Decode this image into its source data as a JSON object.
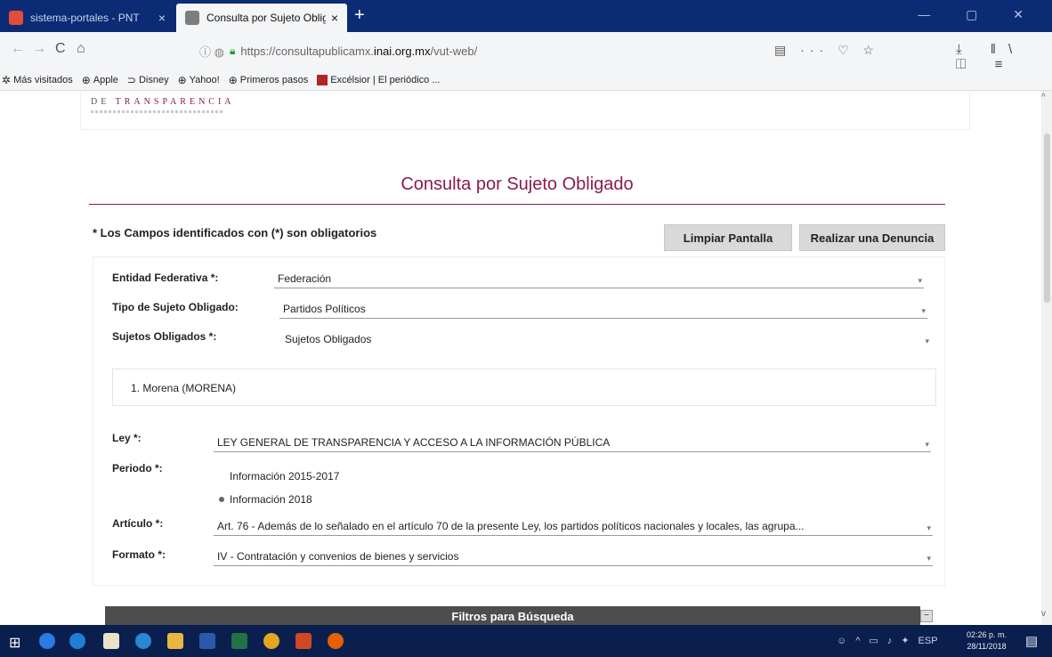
{
  "browser": {
    "tabs": [
      {
        "label": "sistema-portales - PNT",
        "close": "×",
        "active": false
      },
      {
        "label": "Consulta por Sujeto Obligado",
        "close": "×",
        "active": true
      }
    ],
    "new_tab": "+",
    "nav": {
      "back": "←",
      "forward": "→",
      "reload": "C",
      "home": "⌂"
    },
    "url_prefix": "https://consultapublicamx.",
    "url_domain": "inai.org.mx",
    "url_suffix": "/vut-web/",
    "url_actions": "▤ ··· ♡ ☆",
    "toolbar_right": "⤓ ‖\\ ◫ ≡",
    "bookmarks": [
      {
        "label": "Más visitados",
        "icon": "gear-icon"
      },
      {
        "label": "Apple",
        "icon": "globe-icon"
      },
      {
        "label": "Disney",
        "icon": "disney-icon"
      },
      {
        "label": "Yahoo!",
        "icon": "globe-icon"
      },
      {
        "label": "Primeros pasos",
        "icon": "globe-icon"
      },
      {
        "label": "Excélsior | El periódico ...",
        "icon": "excelsior-icon"
      }
    ]
  },
  "page": {
    "logo_prefix": "DE ",
    "logo_accent": "TRANSPARENCIA",
    "title": "Consulta por Sujeto Obligado",
    "required_note": "* Los Campos identificados con (*) son obligatorios",
    "clear_button": "Limpiar Pantalla",
    "report_button": "Realizar una Denuncia",
    "form": {
      "entidad_label": "Entidad Federativa *:",
      "entidad_value": "Federación",
      "tipo_label": "Tipo de Sujeto Obligado:",
      "tipo_value": "Partidos Políticos",
      "sujetos_label": "Sujetos Obligados *:",
      "sujetos_value": "Sujetos Obligados",
      "selected_items": [
        "1. Morena (MORENA)"
      ],
      "ley_label": "Ley *:",
      "ley_value": "LEY GENERAL DE TRANSPARENCIA Y ACCESO A LA INFORMACIÓN PÚBLICA",
      "periodo_label": "Periodo *:",
      "periodo_options": [
        {
          "label": "Información 2015-2017",
          "selected": false
        },
        {
          "label": "Información 2018",
          "selected": true
        }
      ],
      "articulo_label": "Artículo *:",
      "articulo_value": "Art. 76 - Además de lo señalado en el artículo 70 de la presente Ley, los partidos políticos nacionales y locales, las agrupa...",
      "formato_label": "Formato *:",
      "formato_value": "IV - Contratación y convenios de bienes y servicios"
    },
    "filters_bar": "Filtros para Búsqueda",
    "filters_toggle": "−"
  },
  "taskbar": {
    "clock_time": "02:26 p. m.",
    "clock_date": "28/11/2018",
    "language": "ESP",
    "tray_up": "^"
  },
  "colors": {
    "accent": "#8a1b50",
    "tabbar": "#0b2c74",
    "taskbar": "#0b1f4e",
    "button": "#d9d9d9",
    "filters_bar": "#4d4d4d"
  }
}
